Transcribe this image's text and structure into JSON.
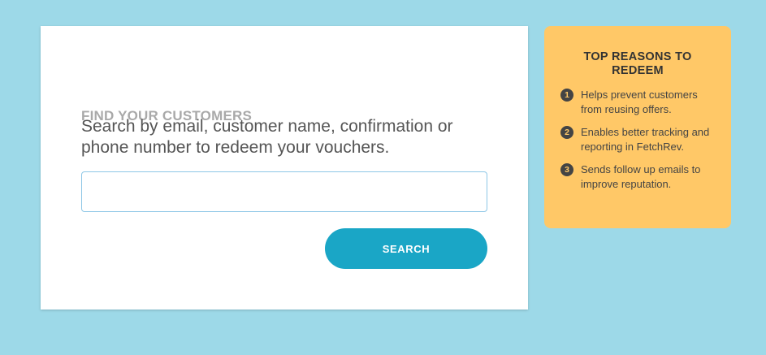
{
  "colors": {
    "background": "#9dd9e8",
    "card": "#ffffff",
    "title": "#a9a9a9",
    "accent": "#1aa6c6",
    "reasons_panel": "#ffc867"
  },
  "search_card": {
    "title": "FIND YOUR CUSTOMERS",
    "description": "Search by email, customer name, confirmation or phone number to redeem your vouchers.",
    "input_value": "",
    "input_placeholder": "",
    "button_label": "SEARCH"
  },
  "reasons": {
    "title": "TOP REASONS TO REDEEM",
    "items": [
      {
        "number": "1",
        "text": "Helps prevent customers from reusing offers."
      },
      {
        "number": "2",
        "text": "Enables better tracking and reporting in FetchRev."
      },
      {
        "number": "3",
        "text": "Sends follow up emails to improve reputation."
      }
    ]
  }
}
